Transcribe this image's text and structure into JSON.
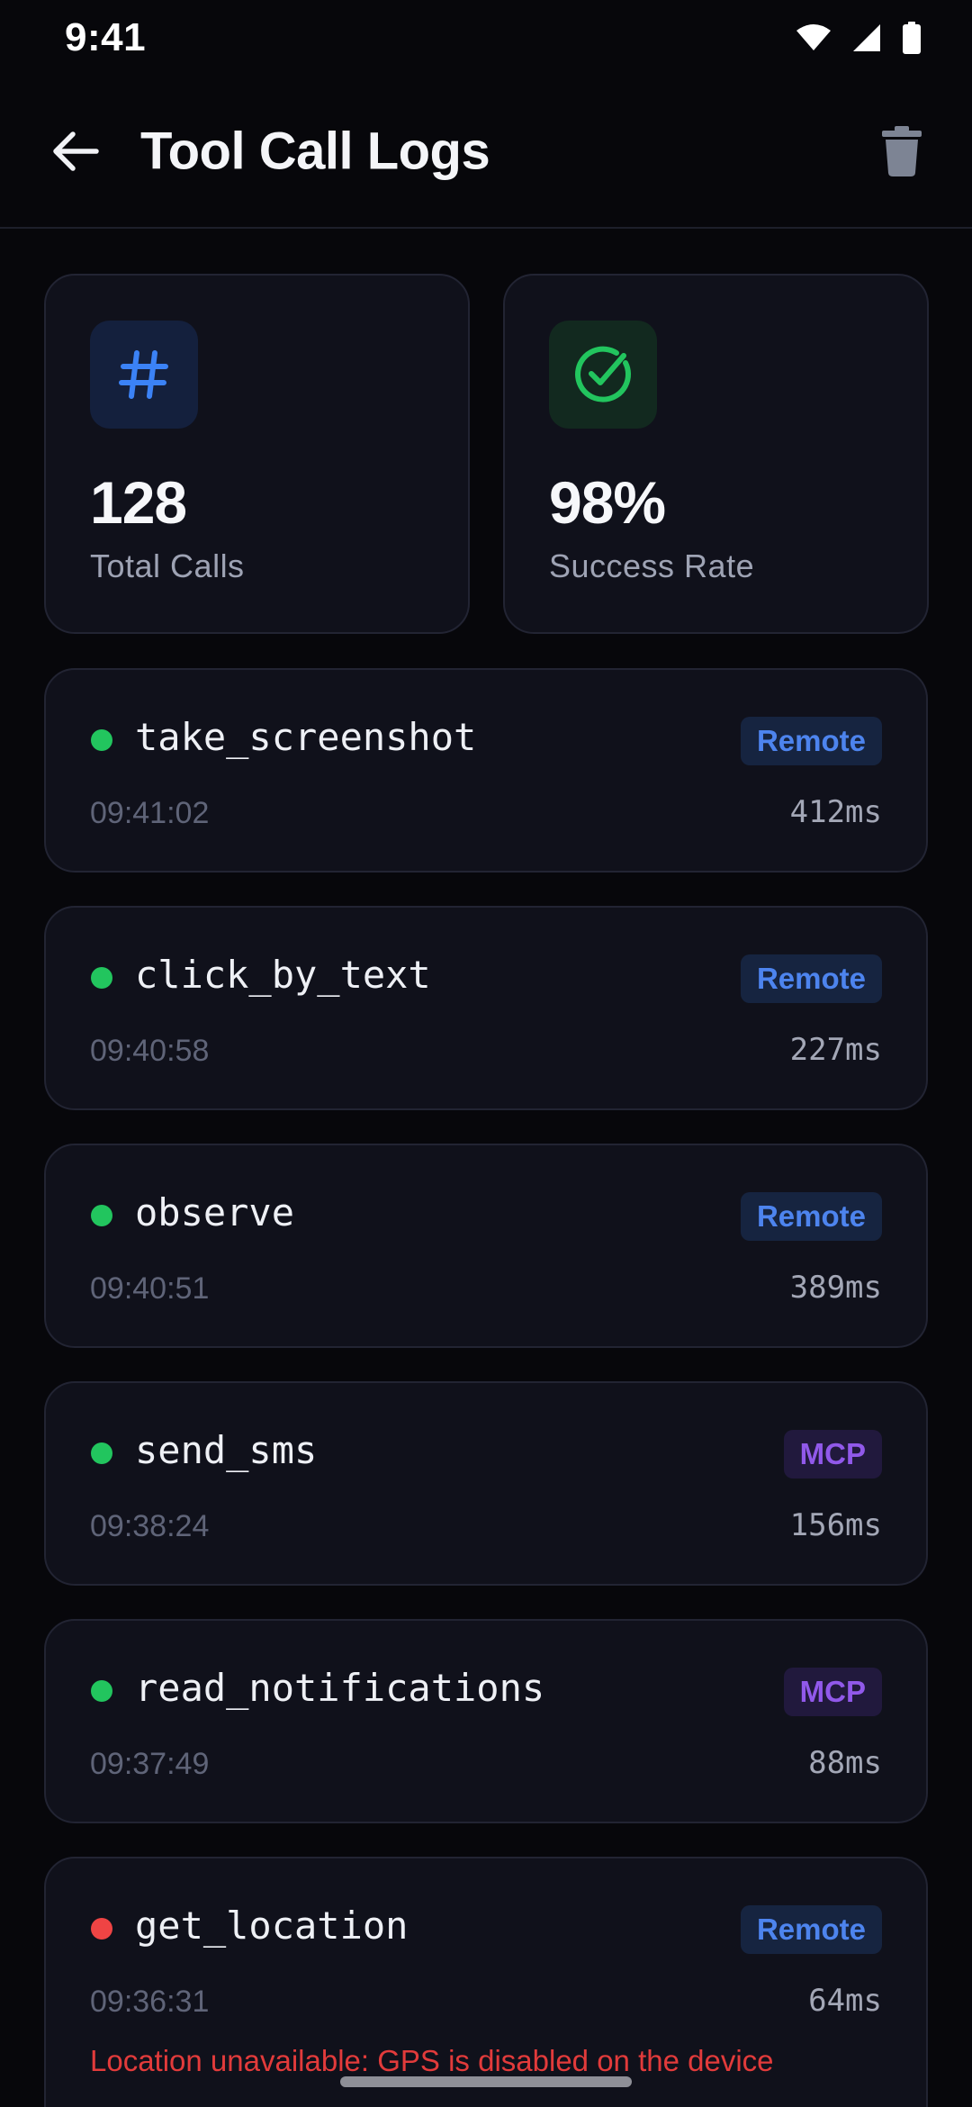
{
  "status_bar": {
    "time": "9:41"
  },
  "header": {
    "title": "Tool Call Logs"
  },
  "stats": [
    {
      "value": "128",
      "label": "Total Calls",
      "icon": "hash-icon",
      "color": "#3b82f6"
    },
    {
      "value": "98%",
      "label": "Success Rate",
      "icon": "check-circle-icon",
      "color": "#22c55e"
    }
  ],
  "logs": [
    {
      "name": "take_screenshot",
      "badge": "Remote",
      "time": "09:41:02",
      "duration": "412ms",
      "status": "success"
    },
    {
      "name": "click_by_text",
      "badge": "Remote",
      "time": "09:40:58",
      "duration": "227ms",
      "status": "success"
    },
    {
      "name": "observe",
      "badge": "Remote",
      "time": "09:40:51",
      "duration": "389ms",
      "status": "success"
    },
    {
      "name": "send_sms",
      "badge": "MCP",
      "time": "09:38:24",
      "duration": "156ms",
      "status": "success"
    },
    {
      "name": "read_notifications",
      "badge": "MCP",
      "time": "09:37:49",
      "duration": "88ms",
      "status": "success"
    },
    {
      "name": "get_location",
      "badge": "Remote",
      "time": "09:36:31",
      "duration": "64ms",
      "status": "error",
      "error": "Location unavailable: GPS is disabled on the device"
    }
  ],
  "colors": {
    "success": "#22c55e",
    "error": "#ef4444",
    "remote": "#4d84ee",
    "mcp": "#9159ea"
  }
}
